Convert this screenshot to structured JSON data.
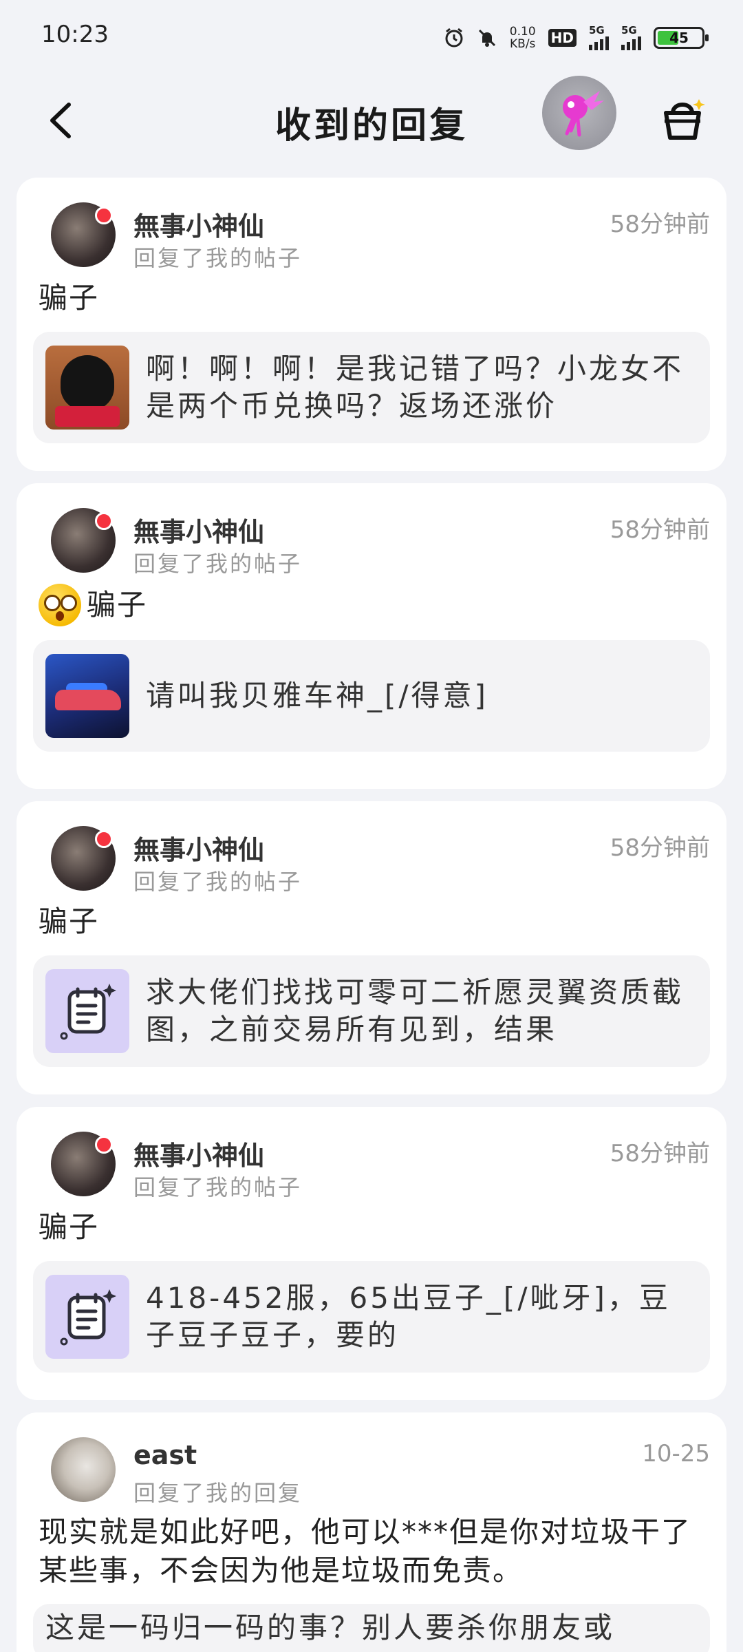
{
  "status_bar": {
    "time": "10:23",
    "net_speed_value": "0.10",
    "net_speed_unit": "KB/s",
    "hd_label": "HD",
    "signal1_label": "5G",
    "signal2_label": "5G",
    "battery": "45"
  },
  "header": {
    "title": "收到的回复"
  },
  "replies": [
    {
      "username": "無事小神仙",
      "subtitle": "回复了我的帖子",
      "time": "58分钟前",
      "text": "骗子",
      "quote": "啊！啊！啊！是我记错了吗？小龙女不是两个币兑换吗？返场还涨价"
    },
    {
      "username": "無事小神仙",
      "subtitle": "回复了我的帖子",
      "time": "58分钟前",
      "text": "骗子",
      "quote": "请叫我贝雅车神_[/得意]"
    },
    {
      "username": "無事小神仙",
      "subtitle": "回复了我的帖子",
      "time": "58分钟前",
      "text": "骗子",
      "quote": "求大佬们找找可零可二祈愿灵翼资质截图，之前交易所有见到，结果"
    },
    {
      "username": "無事小神仙",
      "subtitle": "回复了我的帖子",
      "time": "58分钟前",
      "text": "骗子",
      "quote": "418-452服，65出豆子_[/呲牙]，豆子豆子豆子，要的"
    },
    {
      "username": "east",
      "subtitle": "回复了我的回复",
      "time": "10-25",
      "text": "现实就是如此好吧，他可以***但是你对垃圾干了某些事，不会因为他是垃圾而免责。",
      "quote": "这是一码归一码的事？别人要杀你朋友或"
    }
  ]
}
